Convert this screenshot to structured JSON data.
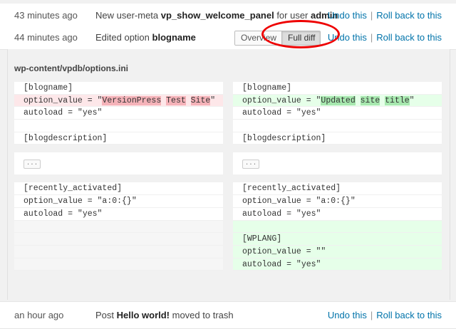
{
  "rows": [
    {
      "time": "43 minutes ago",
      "message_prefix": "New user-meta ",
      "message_bold1": "vp_show_welcome_panel",
      "message_mid": " for user ",
      "message_bold2": "admin",
      "undo_label": "Undo this",
      "rollback_label": "Roll back to this"
    },
    {
      "time": "44 minutes ago",
      "message_prefix": "Edited option ",
      "message_bold1": "blogname",
      "undo_label": "Undo this",
      "rollback_label": "Roll back to this",
      "toggle": {
        "overview_label": "Overview",
        "fulldiff_label": "Full diff",
        "active": "Full diff"
      }
    },
    {
      "time": "an hour ago",
      "message_prefix": "Post ",
      "message_bold1": "Hello world!",
      "message_suffix": " moved to trash",
      "undo_label": "Undo this",
      "rollback_label": "Roll back to this"
    }
  ],
  "separator": "|",
  "diff": {
    "file_path": "wp-content/vpdb/options.ini",
    "collapse_label": "...",
    "left": {
      "block1": [
        "[blogname]",
        {
          "pre": "option_value = \"",
          "words": [
            "VersionPress",
            " ",
            "Test",
            " ",
            "Site"
          ],
          "post": "\""
        },
        "autoload = \"yes\"",
        "",
        "[blogdescription]"
      ],
      "block2": [
        "[recently_activated]",
        "option_value = \"a:0:{}\"",
        "autoload = \"yes\"",
        "",
        "",
        "",
        ""
      ]
    },
    "right": {
      "block1": [
        "[blogname]",
        {
          "pre": "option_value = \"",
          "words": [
            "Updated",
            " ",
            "site",
            " ",
            "title"
          ],
          "post": "\""
        },
        "autoload = \"yes\"",
        "",
        "[blogdescription]"
      ],
      "block2": [
        "[recently_activated]",
        "option_value = \"a:0:{}\"",
        "autoload = \"yes\"",
        "",
        "[WPLANG]",
        "option_value = \"\"",
        "autoload = \"yes\""
      ]
    }
  },
  "colors": {
    "link": "#0073aa",
    "annotation": "#e00000",
    "removed": "#fde7e9",
    "added": "#e6ffe9"
  }
}
